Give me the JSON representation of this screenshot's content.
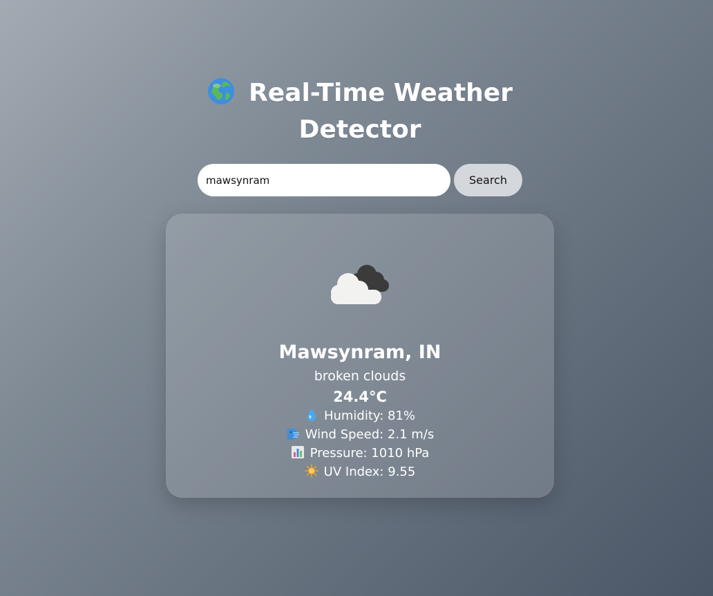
{
  "header": {
    "icon": "globe-icon",
    "title_line1": "Real-Time Weather",
    "title_line2": "Detector"
  },
  "search": {
    "value": "mawsynram",
    "button_label": "Search"
  },
  "weather": {
    "icon": "broken-clouds-icon",
    "city": "Mawsynram, IN",
    "description": "broken clouds",
    "temperature": "24.4°C",
    "humidity": "Humidity: 81%",
    "wind": "Wind Speed: 2.1 m/s",
    "pressure": "Pressure: 1010 hPa",
    "uv": "UV Index: 9.55"
  },
  "colors": {
    "background_start": "#a3aab2",
    "background_end": "#4a5666",
    "button": "#d4d7db"
  }
}
